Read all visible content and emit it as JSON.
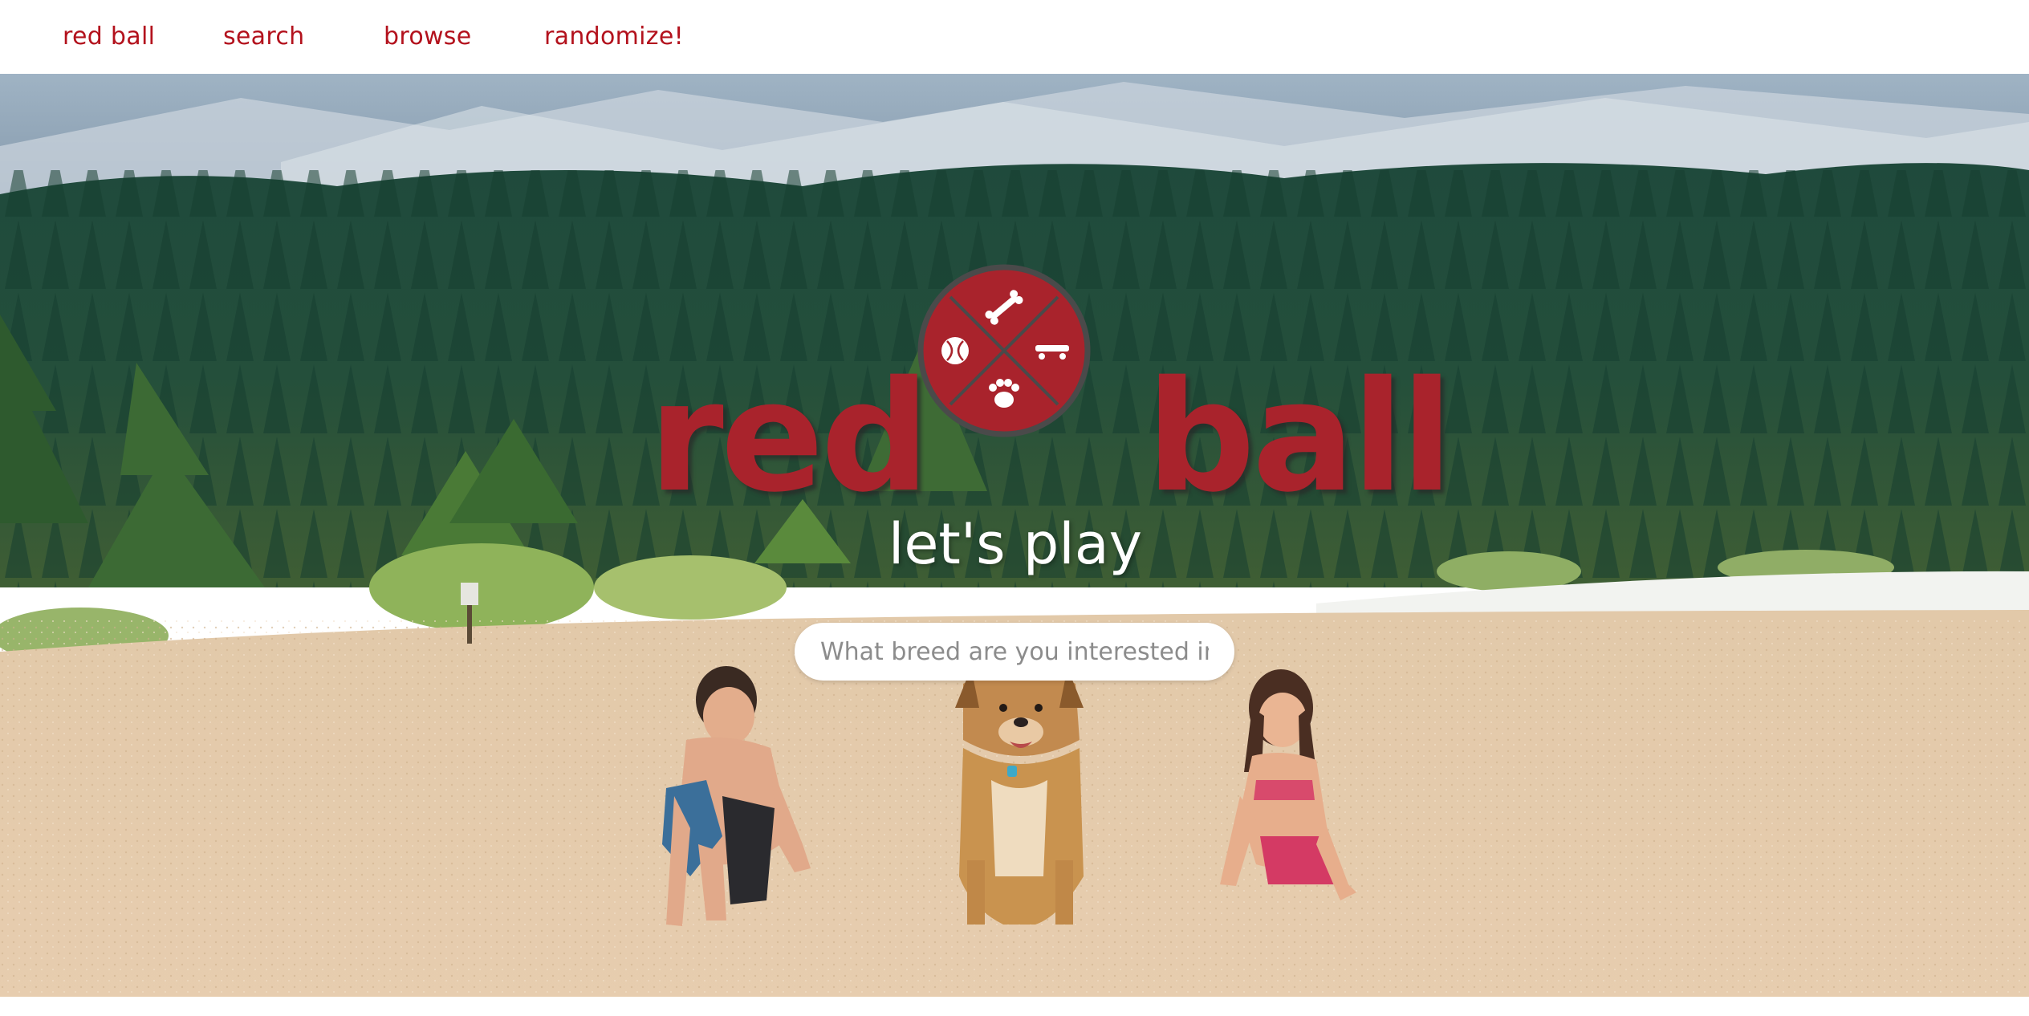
{
  "nav": {
    "items": [
      {
        "label": "red ball"
      },
      {
        "label": "search"
      },
      {
        "label": "browse"
      },
      {
        "label": "randomize!"
      }
    ]
  },
  "hero": {
    "title_left": "red",
    "title_right": "ball",
    "tagline": "let's play",
    "search_placeholder": "What breed are you interested in?",
    "logo_icons": [
      "ball-icon",
      "bone-icon",
      "skateboard-icon",
      "paw-icon"
    ]
  },
  "colors": {
    "brand_red": "#a9232c",
    "nav_text": "#b3121d"
  }
}
